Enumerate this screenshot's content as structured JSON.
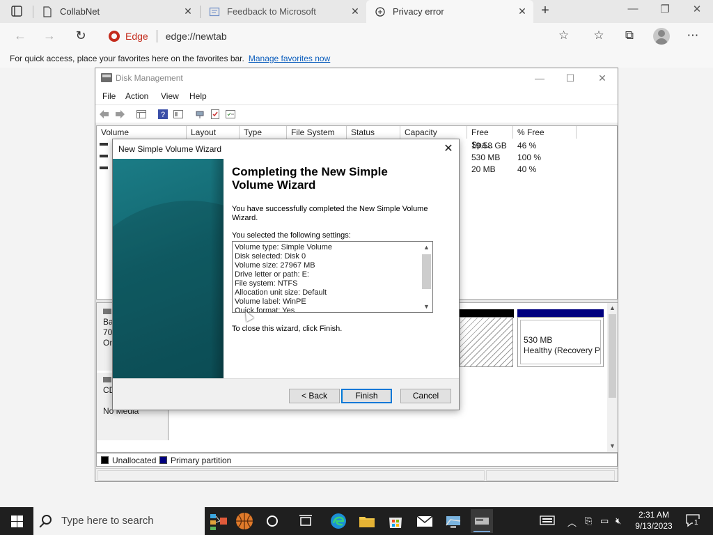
{
  "browser": {
    "tabs": [
      {
        "title": "CollabNet"
      },
      {
        "title": "Feedback to Microsoft"
      },
      {
        "title": "Privacy error"
      }
    ],
    "address": {
      "brand": "Edge",
      "url": "edge://newtab"
    },
    "favorites_bar": {
      "text": "For quick access, place your favorites here on the favorites bar.",
      "link": "Manage favorites now"
    }
  },
  "disk_management": {
    "title": "Disk Management",
    "menu": [
      "File",
      "Action",
      "View",
      "Help"
    ],
    "columns": [
      "Volume",
      "Layout",
      "Type",
      "File System",
      "Status",
      "Capacity",
      "Free Spa...",
      "% Free"
    ],
    "rows": [
      {
        "free": "19.58 GB",
        "pct": "46 %"
      },
      {
        "free": "530 MB",
        "pct": "100 %"
      },
      {
        "free": "20 MB",
        "pct": "40 %"
      }
    ],
    "disks": [
      {
        "l1": "Ba",
        "l2": "70.",
        "l3": "On"
      },
      {
        "l1": "CD",
        "l2": "No Media"
      }
    ],
    "recovery_partition": {
      "size": "530 MB",
      "status": "Healthy (Recovery Pa"
    },
    "legend": [
      {
        "label": "Unallocated",
        "color": "#000000"
      },
      {
        "label": "Primary partition",
        "color": "#00007f"
      }
    ]
  },
  "wizard": {
    "title": "New Simple Volume Wizard",
    "heading": "Completing the New Simple Volume Wizard",
    "success_text": "You have successfully completed the New Simple Volume Wizard.",
    "settings_label": "You selected the following settings:",
    "settings": [
      "Volume type: Simple Volume",
      "Disk selected: Disk 0",
      "Volume size: 27967 MB",
      "Drive letter or path: E:",
      "File system: NTFS",
      "Allocation unit size: Default",
      "Volume label: WinPE",
      "Quick format: Yes"
    ],
    "close_text": "To close this wizard, click Finish.",
    "buttons": {
      "back": "< Back",
      "finish": "Finish",
      "cancel": "Cancel"
    }
  },
  "taskbar": {
    "search_placeholder": "Type here to search",
    "time": "2:31 AM",
    "date": "9/13/2023",
    "notification_count": "1"
  }
}
